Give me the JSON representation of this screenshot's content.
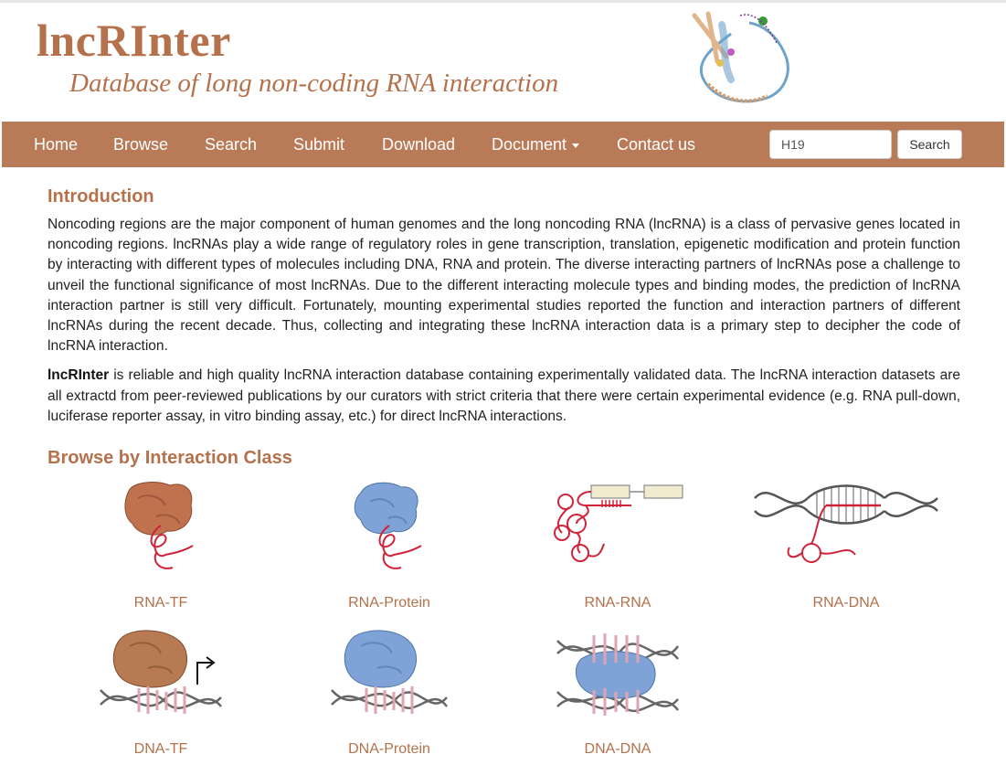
{
  "header": {
    "title": "lncRInter",
    "subtitle": "Database of long non-coding RNA interaction"
  },
  "nav": {
    "home": "Home",
    "browse": "Browse",
    "search": "Search",
    "submit": "Submit",
    "download": "Download",
    "document": "Document",
    "contact": "Contact us",
    "search_value": "H19",
    "search_button": "Search"
  },
  "intro": {
    "heading": "Introduction",
    "para1": "Noncoding regions are the major component of human genomes and the long noncoding RNA (lncRNA) is a class of pervasive genes located in noncoding regions. lncRNAs play a wide range of regulatory roles in gene transcription, translation, epigenetic modification and protein function by interacting with different types of molecules including DNA, RNA and protein. The diverse interacting partners of lncRNAs pose a challenge to unveil the functional significance of most lncRNAs. Due to the different interacting molecule types and binding modes, the prediction of lncRNA interaction partner is still very difficult. Fortunately, mounting experimental studies reported the function and interaction partners of different lncRNAs during the recent decade. Thus, collecting and integrating these lncRNA interaction data is a primary step to decipher the code of lncRNA interaction.",
    "para2_bold": "lncRInter",
    "para2_rest": " is reliable and high quality lncRNA interaction database containing experimentally validated data. The lncRNA interaction datasets are all extractd from peer-reviewed publications by our curators with strict criteria that there were certain experimental evidence (e.g. RNA pull-down, luciferase reporter assay, in vitro binding assay, etc.) for direct lncRNA interactions."
  },
  "browse": {
    "heading": "Browse by Interaction Class",
    "classes": [
      "RNA-TF",
      "RNA-Protein",
      "RNA-RNA",
      "RNA-DNA",
      "DNA-TF",
      "DNA-Protein",
      "DNA-DNA"
    ]
  },
  "colors": {
    "brand": "#b5714b",
    "navbar": "#b97a57",
    "rna": "#d0233a",
    "tf_protein": "#c0724e",
    "protein": "#7fa3d6"
  }
}
